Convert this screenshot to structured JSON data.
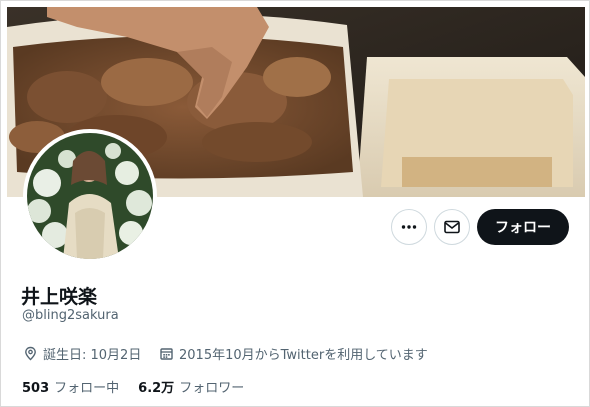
{
  "profile": {
    "name": "井上咲楽",
    "handle": "@bling2sakura",
    "birthday": "誕生日: 10月2日",
    "joined": "2015年10月からTwitterを利用しています"
  },
  "actions": {
    "more_icon": "more-horizontal-icon",
    "message_icon": "mail-icon",
    "follow_label": "フォロー"
  },
  "stats": {
    "following_count": "503",
    "following_label": "フォロー中",
    "followers_count": "6.2万",
    "followers_label": "フォロワー"
  },
  "colors": {
    "primary_text": "#0f1419",
    "secondary_text": "#536471",
    "follow_button": "#0f1419",
    "border": "#cfd9de"
  }
}
